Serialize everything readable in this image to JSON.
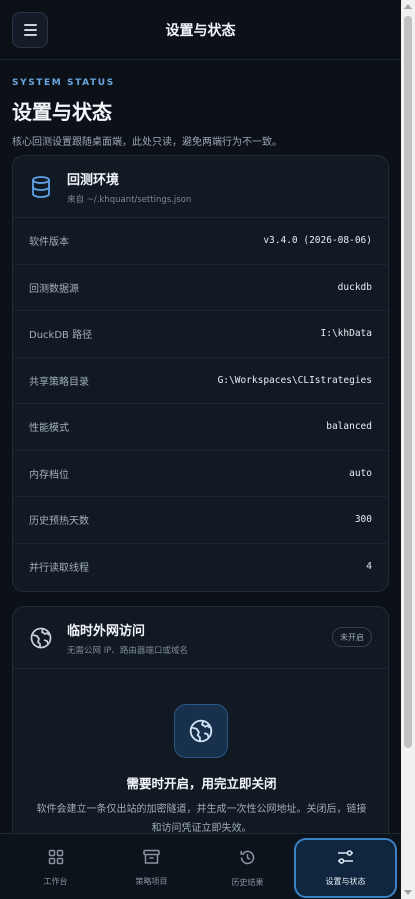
{
  "topbar": {
    "title": "设置与状态"
  },
  "header": {
    "eyebrow": "SYSTEM STATUS",
    "title": "设置与状态",
    "description": "核心回测设置跟随桌面端，此处只读，避免两端行为不一致。"
  },
  "backtest_env": {
    "title": "回测环境",
    "subtitle": "来自 ~/.khquant/settings.json",
    "rows": [
      {
        "label": "软件版本",
        "value": "v3.4.0 (2026-08-06)"
      },
      {
        "label": "回测数据源",
        "value": "duckdb"
      },
      {
        "label": "DuckDB 路径",
        "value": "I:\\khData"
      },
      {
        "label": "共享策略目录",
        "value": "G:\\Workspaces\\CLIstrategies"
      },
      {
        "label": "性能模式",
        "value": "balanced"
      },
      {
        "label": "内存档位",
        "value": "auto"
      },
      {
        "label": "历史预热天数",
        "value": "300"
      },
      {
        "label": "并行读取线程",
        "value": "4"
      }
    ]
  },
  "public_access": {
    "title": "临时外网访问",
    "subtitle": "无需公网 IP、路由器端口或域名",
    "badge": "未开启",
    "hero_title": "需要时开启，用完立即关闭",
    "hero_desc": "软件会建立一条仅出站的加密隧道，并生成一次性公网地址。关闭后，链接和访问凭证立即失效。"
  },
  "bottom_nav": [
    {
      "label": "工作台",
      "icon": "grid-icon"
    },
    {
      "label": "策略项目",
      "icon": "archive-icon"
    },
    {
      "label": "历史结果",
      "icon": "history-icon"
    },
    {
      "label": "设置与状态",
      "icon": "sliders-icon",
      "active": true
    }
  ],
  "colors": {
    "accent": "#3b82c4",
    "background": "#0c1118",
    "card": "#111922"
  }
}
